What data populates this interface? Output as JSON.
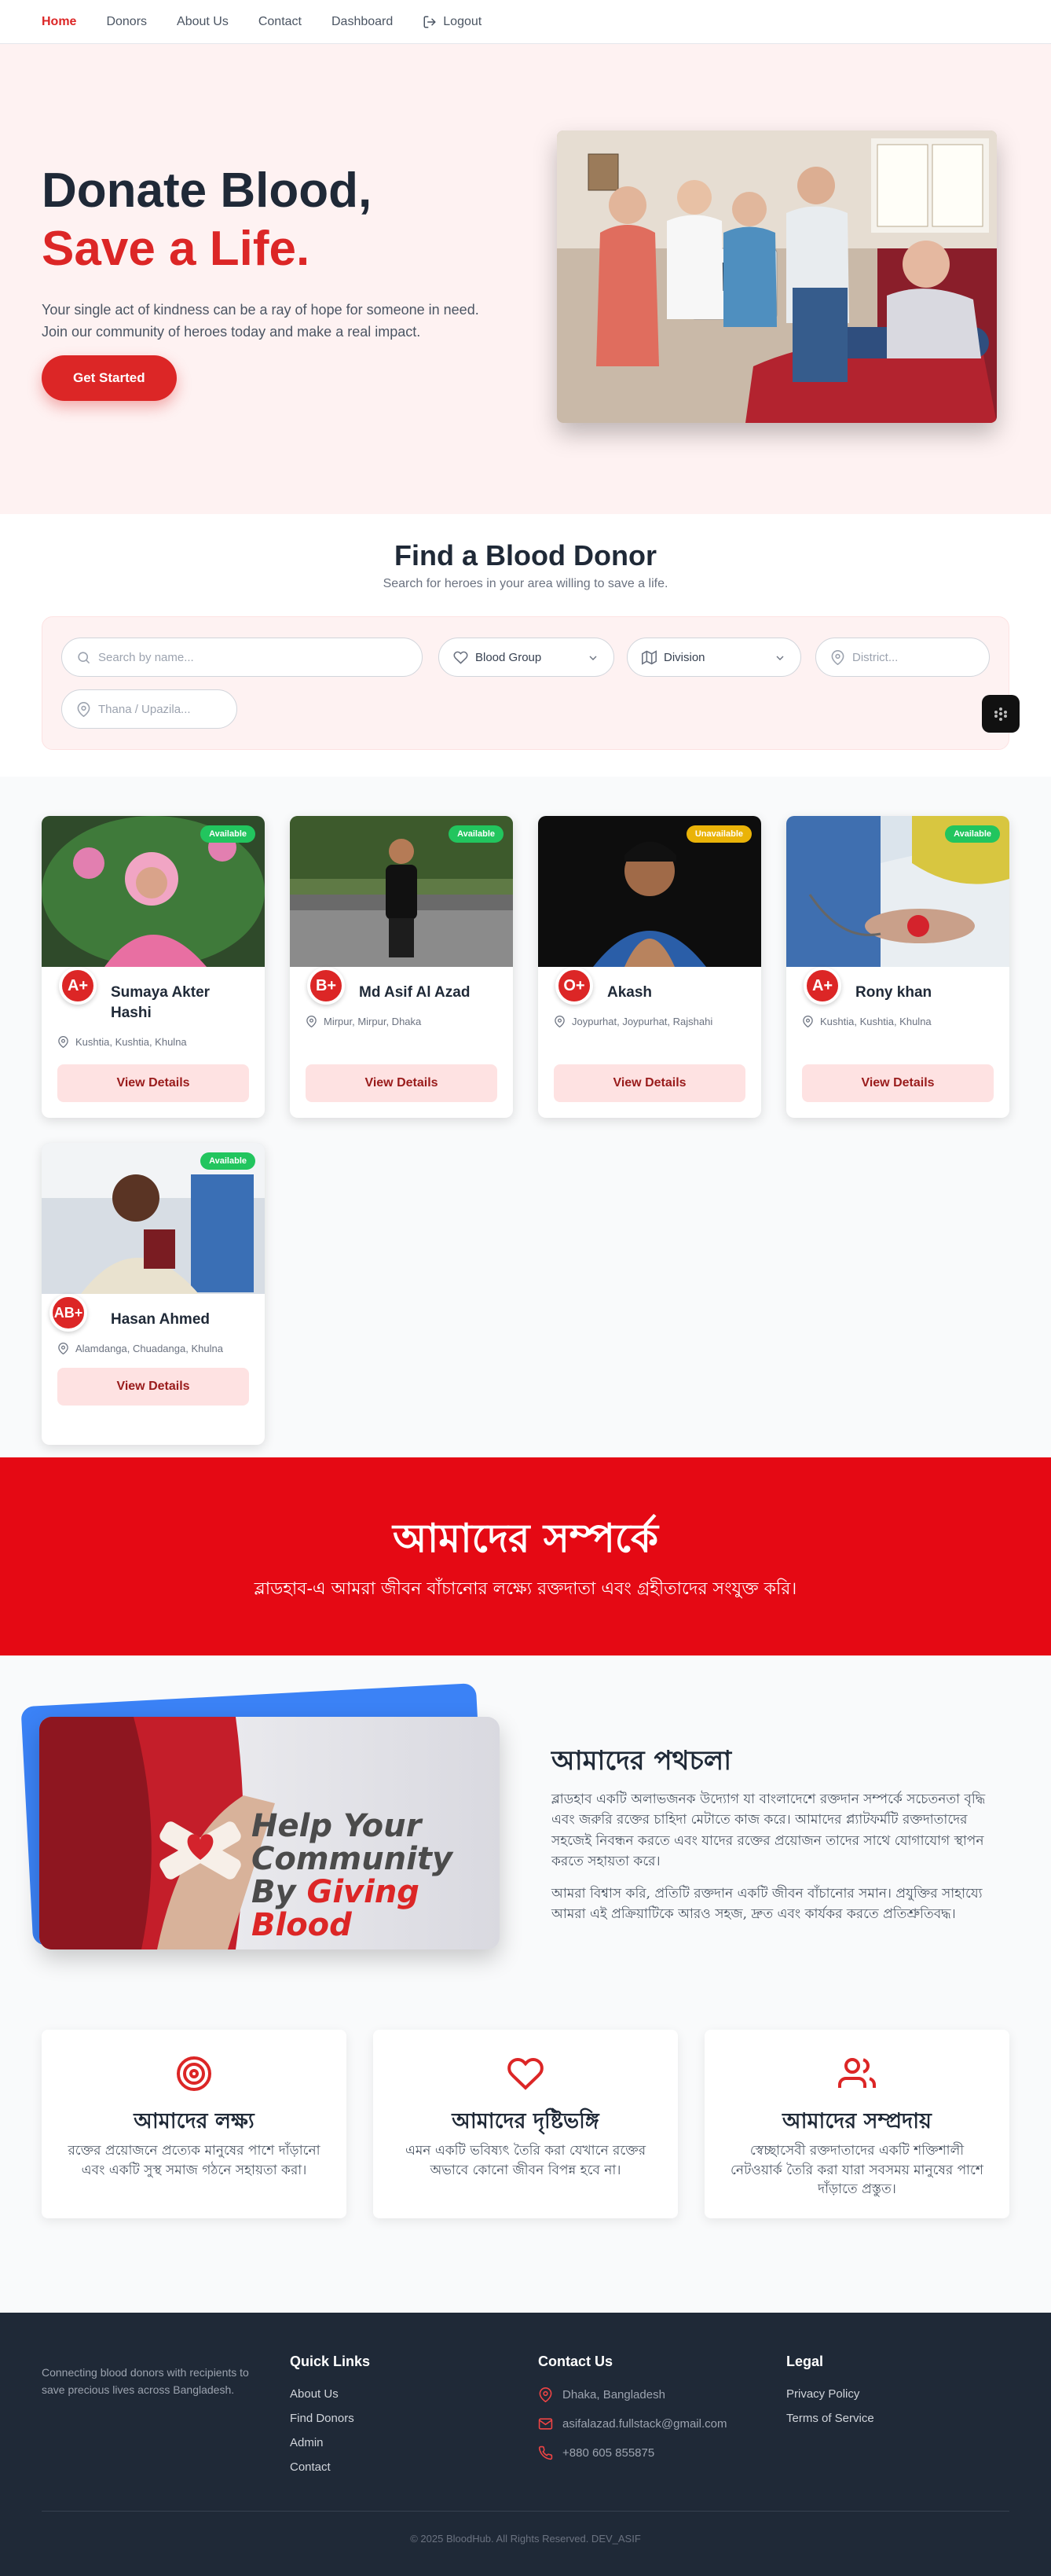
{
  "nav": {
    "items": [
      "Home",
      "Donors",
      "About Us",
      "Contact",
      "Dashboard",
      "Logout"
    ]
  },
  "hero": {
    "title_line1": "Donate Blood,",
    "title_line2": "Save a Life.",
    "description": "Your single act of kindness can be a ray of hope for someone in need. Join our community of heroes today and make a real impact.",
    "cta": "Get Started"
  },
  "search": {
    "title": "Find a Blood Donor",
    "subtitle": "Search for heroes in your area willing to save a life.",
    "name_placeholder": "Search by name...",
    "blood_group": "Blood Group",
    "division": "Division",
    "district_placeholder": "District...",
    "thana_placeholder": "Thana / Upazila..."
  },
  "donors": [
    {
      "name": "Sumaya Akter Hashi",
      "blood": "A+",
      "status": "Available",
      "location": "Kushtia, Kushtia, Khulna",
      "action": "View Details"
    },
    {
      "name": "Md Asif Al Azad",
      "blood": "B+",
      "status": "Available",
      "location": "Mirpur, Mirpur, Dhaka",
      "action": "View Details"
    },
    {
      "name": "Akash",
      "blood": "O+",
      "status": "Unavailable",
      "location": "Joypurhat, Joypurhat, Rajshahi",
      "action": "View Details"
    },
    {
      "name": "Rony khan",
      "blood": "A+",
      "status": "Available",
      "location": "Kushtia, Kushtia, Khulna",
      "action": "View Details"
    },
    {
      "name": "Hasan Ahmed",
      "blood": "AB+",
      "status": "Available",
      "location": "Alamdanga, Chuadanga, Khulna",
      "action": "View Details"
    }
  ],
  "about": {
    "title": "আমাদের সম্পর্কে",
    "subtitle": "ব্লাডহাব-এ আমরা জীবন বাঁচানোর লক্ষ্যে রক্তদাতা এবং গ্রহীতাদের সংযুক্ত করি।"
  },
  "path": {
    "image_text_line1": "Help Your",
    "image_text_line2": "Community",
    "image_text_line3_a": "By",
    "image_text_line3_b": "Giving Blood",
    "title": "আমাদের পথচলা",
    "p1": "ব্লাডহাব একটি অলাভজনক উদ্যোগ যা বাংলাদেশে রক্তদান সম্পর্কে সচেতনতা বৃদ্ধি এবং জরুরি রক্তের চাহিদা মেটাতে কাজ করে। আমাদের প্ল্যাটফর্মটি রক্তদাতাদের সহজেই নিবন্ধন করতে এবং যাদের রক্তের প্রয়োজন তাদের সাথে যোগাযোগ স্থাপন করতে সহায়তা করে।",
    "p2": "আমরা বিশ্বাস করি, প্রতিটি রক্তদান একটি জীবন বাঁচানোর সমান। প্রযুক্তির সাহায্যে আমরা এই প্রক্রিয়াটিকে আরও সহজ, দ্রুত এবং কার্যকর করতে প্রতিশ্রুতিবদ্ধ।"
  },
  "values": [
    {
      "title": "আমাদের লক্ষ্য",
      "desc": "রক্তের প্রয়োজনে প্রত্যেক মানুষের পাশে দাঁড়ানো এবং একটি সুস্থ সমাজ গঠনে সহায়তা করা।"
    },
    {
      "title": "আমাদের দৃষ্টিভঙ্গি",
      "desc": "এমন একটি ভবিষ্যৎ তৈরি করা যেখানে রক্তের অভাবে কোনো জীবন বিপন্ন হবে না।"
    },
    {
      "title": "আমাদের সম্প্রদায়",
      "desc": "স্বেচ্ছাসেবী রক্তদাতাদের একটি শক্তিশালী নেটওয়ার্ক তৈরি করা যারা সবসময় মানুষের পাশে দাঁড়াতে প্রস্তুত।"
    }
  ],
  "footer": {
    "about": "Connecting blood donors with recipients to save precious lives across Bangladesh.",
    "quick_links_title": "Quick Links",
    "quick_links": [
      "About Us",
      "Find Donors",
      "Admin",
      "Contact"
    ],
    "contact_title": "Contact Us",
    "address": "Dhaka, Bangladesh",
    "email": "asifalazad.fullstack@gmail.com",
    "phone": "+880 605 855875",
    "legal_title": "Legal",
    "legal": [
      "Privacy Policy",
      "Terms of Service"
    ],
    "copyright": "© 2025 BloodHub. All Rights Reserved. DEV_ASIF"
  },
  "colors": {
    "brand_red": "#dc2626",
    "banner_red": "#e50914",
    "available_green": "#22c55e",
    "unavailable_amber": "#eab308",
    "footer_bg": "#1f2937"
  }
}
